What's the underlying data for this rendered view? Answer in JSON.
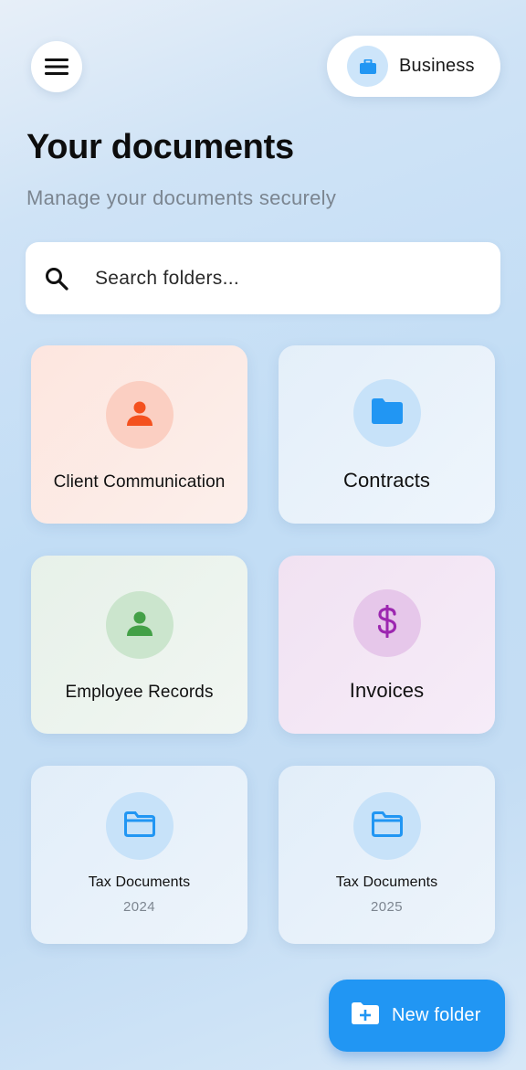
{
  "header": {
    "menu_icon": "hamburger-menu-icon",
    "account": {
      "label": "Business",
      "icon": "briefcase-icon"
    }
  },
  "page": {
    "title": "Your documents",
    "subtitle": "Manage your documents securely"
  },
  "search": {
    "placeholder": "Search folders...",
    "value": "",
    "icon": "search-icon"
  },
  "folders": [
    {
      "name": "Client Communication",
      "icon": "person-icon",
      "color": "#f4511e",
      "bg": "#fbcfc2"
    },
    {
      "name": "Contracts",
      "icon": "folder-icon",
      "color": "#2196f3",
      "bg": "#c7e2f9"
    },
    {
      "name": "Employee Records",
      "icon": "person-icon",
      "color": "#43a047",
      "bg": "#cbe5cd"
    },
    {
      "name": "Invoices",
      "icon": "dollar-icon",
      "color": "#9c27b0",
      "bg": "#e6c7ea"
    },
    {
      "name": "Tax Documents",
      "year": "2024",
      "icon": "folder-outline-icon",
      "color": "#2196f3",
      "bg": "#c7e2f9"
    },
    {
      "name": "Tax Documents",
      "year": "2025",
      "icon": "folder-outline-icon",
      "color": "#2196f3",
      "bg": "#c7e2f9"
    }
  ],
  "fab": {
    "label": "New folder",
    "icon": "create-folder-icon",
    "color": "#2196f3"
  }
}
